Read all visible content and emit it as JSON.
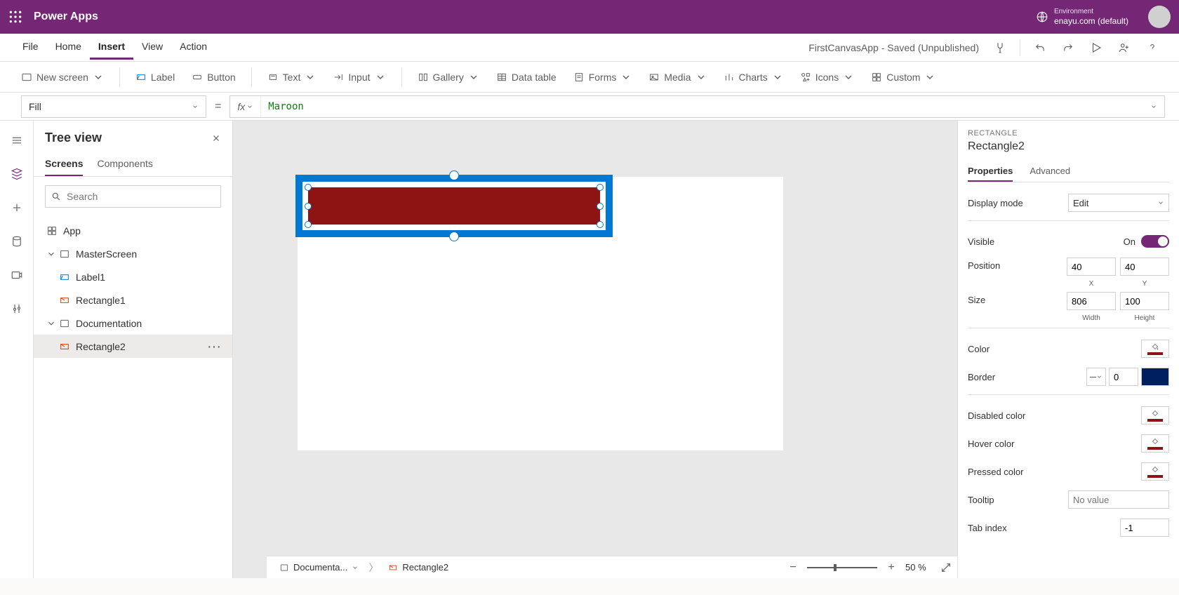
{
  "header": {
    "appTitle": "Power Apps",
    "envLabel": "Environment",
    "envName": "enayu.com (default)"
  },
  "menubar": {
    "file": "File",
    "home": "Home",
    "insert": "Insert",
    "view": "View",
    "action": "Action",
    "docTitle": "FirstCanvasApp - Saved (Unpublished)"
  },
  "ribbon": {
    "newScreen": "New screen",
    "label": "Label",
    "button": "Button",
    "text": "Text",
    "input": "Input",
    "gallery": "Gallery",
    "dataTable": "Data table",
    "forms": "Forms",
    "media": "Media",
    "charts": "Charts",
    "icons": "Icons",
    "custom": "Custom"
  },
  "formula": {
    "property": "Fill",
    "equals": "=",
    "fxLabel": "fx",
    "value": "Maroon"
  },
  "treePanel": {
    "title": "Tree view",
    "tabs": {
      "screens": "Screens",
      "components": "Components"
    },
    "searchPlaceholder": "Search",
    "items": {
      "app": "App",
      "masterScreen": "MasterScreen",
      "label1": "Label1",
      "rectangle1": "Rectangle1",
      "documentation": "Documentation",
      "rectangle2": "Rectangle2"
    }
  },
  "propsPanel": {
    "heading": "RECTANGLE",
    "name": "Rectangle2",
    "tabs": {
      "properties": "Properties",
      "advanced": "Advanced"
    },
    "rows": {
      "displayMode": "Display mode",
      "displayModeValue": "Edit",
      "visible": "Visible",
      "visibleValue": "On",
      "position": "Position",
      "posX": "40",
      "posY": "40",
      "subX": "X",
      "subY": "Y",
      "size": "Size",
      "width": "806",
      "height": "100",
      "subW": "Width",
      "subH": "Height",
      "color": "Color",
      "border": "Border",
      "borderValue": "0",
      "disabledColor": "Disabled color",
      "hoverColor": "Hover color",
      "pressedColor": "Pressed color",
      "tooltip": "Tooltip",
      "tooltipPlaceholder": "No value",
      "tabIndex": "Tab index",
      "tabIndexValue": "-1"
    }
  },
  "bottomBar": {
    "crumbScreen": "Documenta...",
    "crumbItem": "Rectangle2",
    "zoomPct": "50  %"
  }
}
